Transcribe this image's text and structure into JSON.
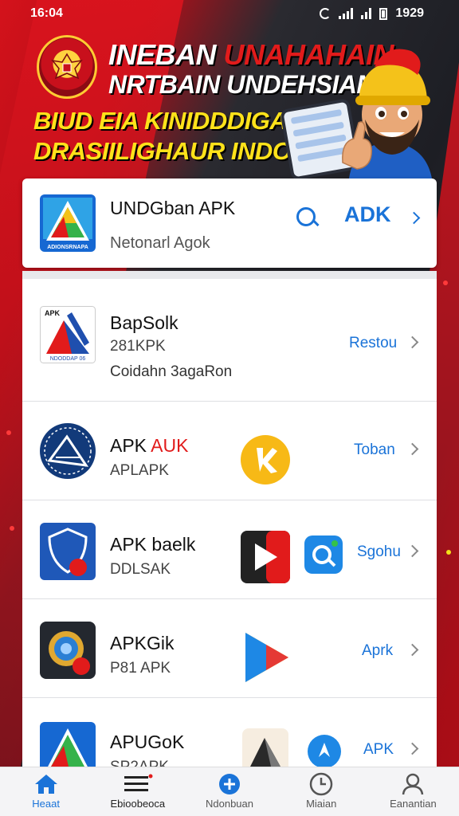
{
  "status_bar": {
    "time": "16:04",
    "right_time": "1929"
  },
  "banner": {
    "line1_white": "INEBAN ",
    "line1_red": "UNAHAHAIN",
    "line2": "NRTBAIN UNDEHSIAN",
    "line3": "BIUD EIA KINIDDDIGAN",
    "line4": "DRASIILIGHAUR INDOOBI!"
  },
  "search_card": {
    "app_icon_caption": "ADIONSRNAPA",
    "title": "UNDGban APK",
    "subtitle": "Netonarl Agok",
    "apk_label": "ADK"
  },
  "list": {
    "items": [
      {
        "icon_top_text": "APK",
        "icon_bottom_text": "NDODDAP 06",
        "title": "BapSolk",
        "sub": "281KPK",
        "sub2": "Coidahn 3agaRon",
        "action": "Restou"
      },
      {
        "title_black": "APK ",
        "title_red": "AUK",
        "sub": "APLAPK",
        "action": "Toban"
      },
      {
        "title": "APK baelk",
        "sub": "DDLSAK",
        "action": "Sgohu"
      },
      {
        "title": "APKGik",
        "sub": "P81 APK",
        "action": "Aprk"
      },
      {
        "title": "APUGoK",
        "sub": "SP2APK",
        "action": "APK"
      }
    ]
  },
  "bottom_nav": {
    "items": [
      {
        "label": "Heaat",
        "icon": "home-icon"
      },
      {
        "label": "Ebioobeoca",
        "icon": "menu-icon"
      },
      {
        "label": "Ndonbuan",
        "icon": "add-icon"
      },
      {
        "label": "Miaian",
        "icon": "clock-icon"
      },
      {
        "label": "Eanantian",
        "icon": "profile-icon"
      }
    ]
  },
  "colors": {
    "accent": "#1a73d8",
    "brand_red": "#e11b1b",
    "banner_yellow": "#ffe21a"
  }
}
